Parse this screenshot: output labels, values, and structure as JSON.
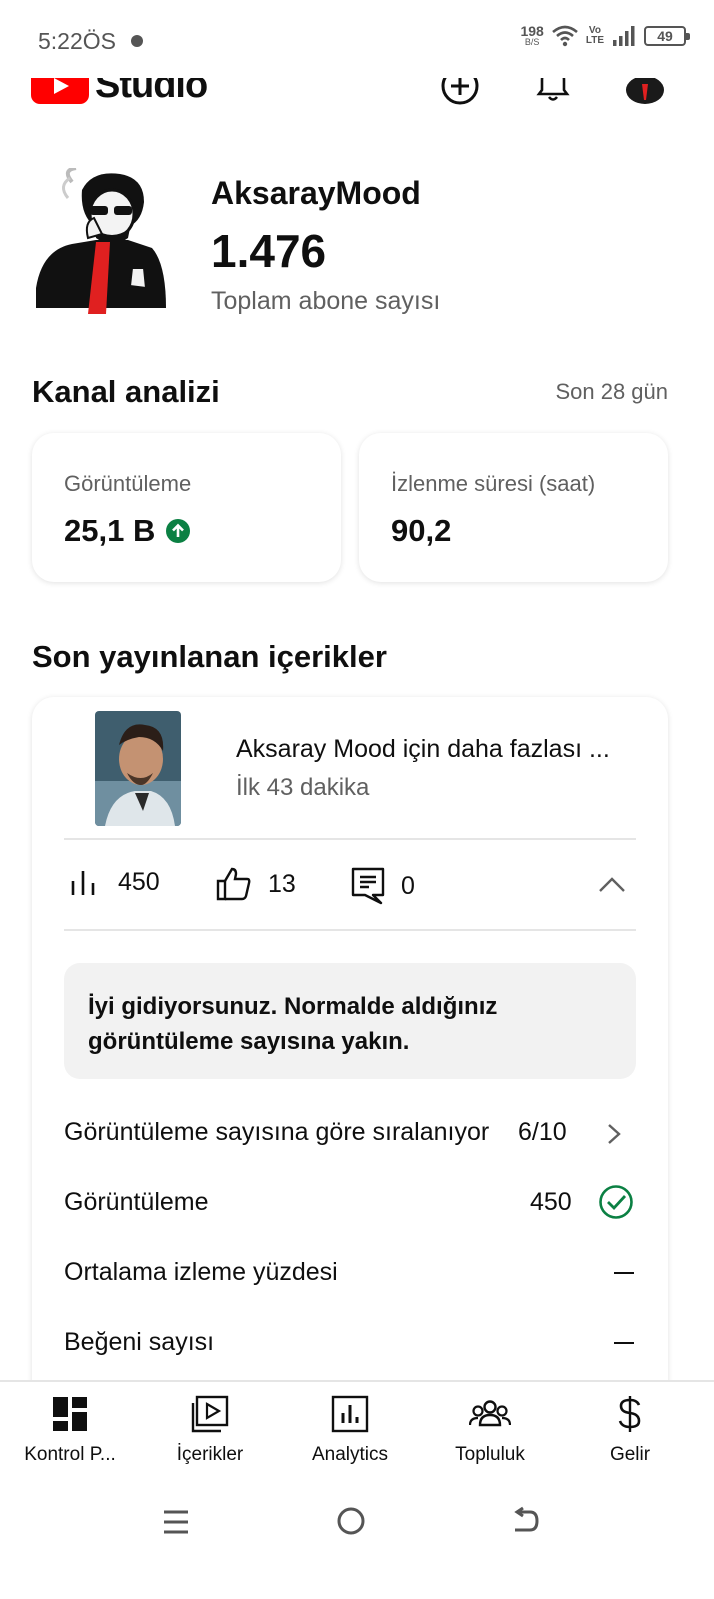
{
  "status_bar": {
    "time": "5:22ÖS",
    "net_speed": "198",
    "net_unit": "B/S",
    "volte_top": "Vo",
    "volte_bottom": "LTE",
    "battery": "49"
  },
  "header": {
    "logo_text": "Studio",
    "icons": [
      "create-icon",
      "notifications-icon",
      "account-avatar"
    ]
  },
  "channel": {
    "name": "AksarayMood",
    "subscriber_count": "1.476",
    "subscriber_label": "Toplam abone sayısı"
  },
  "analytics": {
    "title": "Kanal analizi",
    "period": "Son 28 gün",
    "metrics": [
      {
        "label": "Görüntüleme",
        "value": "25,1 B",
        "trend": "up"
      },
      {
        "label": "İzlenme süresi (saat)",
        "value": "90,2"
      }
    ]
  },
  "recent": {
    "title": "Son yayınlanan içerikler",
    "video": {
      "title": "Aksaray Mood için daha fazlası ...",
      "age": "İlk 43 dakika",
      "views": "450",
      "likes": "13",
      "comments": "0"
    },
    "performance_message": "İyi gidiyorsunuz. Normalde aldığınız görüntüleme sayısına yakın.",
    "rows": [
      {
        "label": "Görüntüleme sayısına göre sıralanıyor",
        "value": "6/10"
      },
      {
        "label": "Görüntüleme",
        "value": "450"
      },
      {
        "label": "Ortalama izleme yüzdesi",
        "value": "—"
      },
      {
        "label": "Beğeni sayısı",
        "value": "—"
      }
    ]
  },
  "bottom_nav": [
    {
      "label": "Kontrol P...",
      "icon": "dashboard-icon"
    },
    {
      "label": "İçerikler",
      "icon": "content-icon"
    },
    {
      "label": "Analytics",
      "icon": "analytics-icon"
    },
    {
      "label": "Topluluk",
      "icon": "community-icon"
    },
    {
      "label": "Gelir",
      "icon": "earn-icon"
    }
  ],
  "colors": {
    "brand_red": "#ff0000",
    "success_green": "#0b8043",
    "text_secondary": "#606060"
  }
}
